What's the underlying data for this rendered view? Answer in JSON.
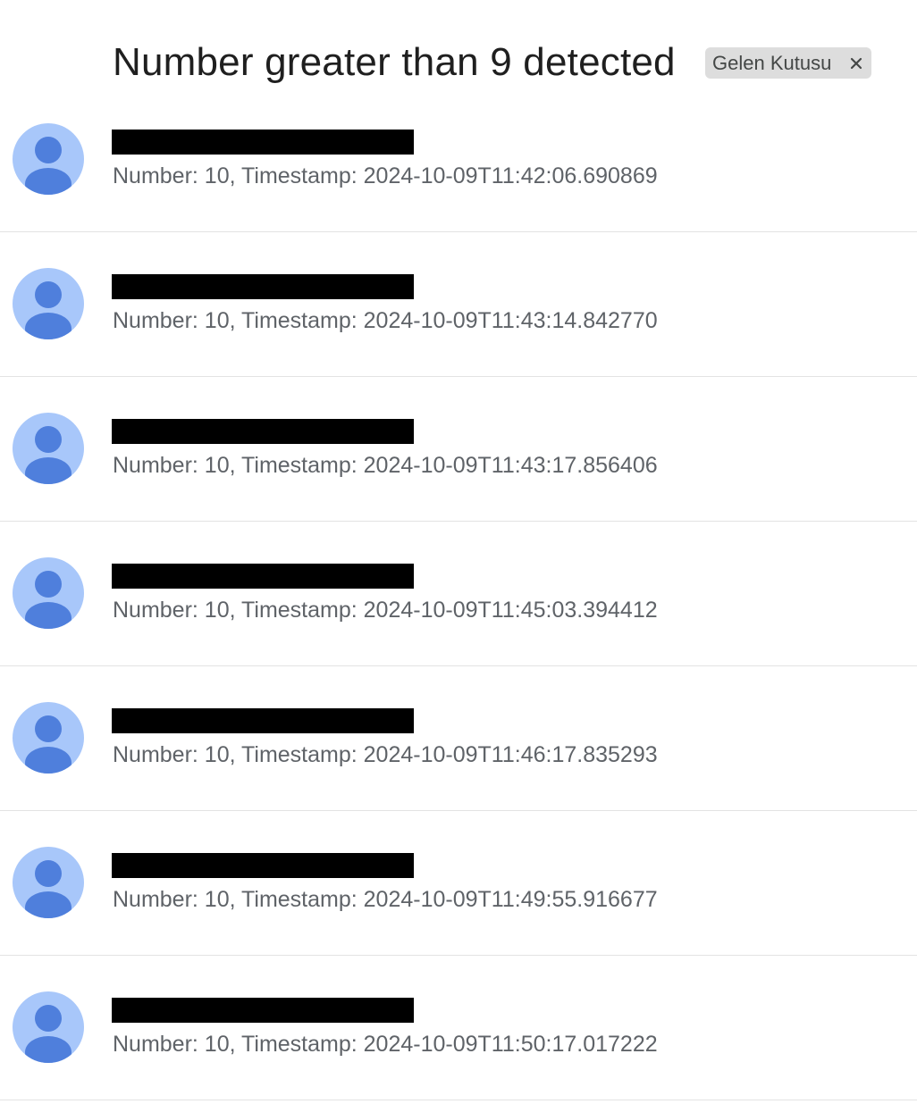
{
  "thread": {
    "subject": "Number greater than 9 detected",
    "label": {
      "text": "Gelen Kutusu",
      "remove_symbol": "×"
    }
  },
  "messages": [
    {
      "sender": "[redacted]",
      "snippet": "Number: 10, Timestamp: 2024-10-09T11:42:06.690869"
    },
    {
      "sender": "[redacted]",
      "snippet": "Number: 10, Timestamp: 2024-10-09T11:43:14.842770"
    },
    {
      "sender": "[redacted]",
      "snippet": "Number: 10, Timestamp: 2024-10-09T11:43:17.856406"
    },
    {
      "sender": "[redacted]",
      "snippet": "Number: 10, Timestamp: 2024-10-09T11:45:03.394412"
    },
    {
      "sender": "[redacted]",
      "snippet": "Number: 10, Timestamp: 2024-10-09T11:46:17.835293"
    },
    {
      "sender": "[redacted]",
      "snippet": "Number: 10, Timestamp: 2024-10-09T11:49:55.916677"
    },
    {
      "sender": "[redacted]",
      "snippet": "Number: 10, Timestamp: 2024-10-09T11:50:17.017222"
    }
  ],
  "icons": {
    "avatar": "default-person-avatar-icon",
    "label_remove": "close-icon"
  },
  "colors": {
    "avatar_background": "#a8c7fa",
    "avatar_figure": "#4f7fdc",
    "chip_background": "#dddddd",
    "redaction": "#000000",
    "snippet_text": "#5f6368",
    "subject_text": "#1f1f1f"
  }
}
